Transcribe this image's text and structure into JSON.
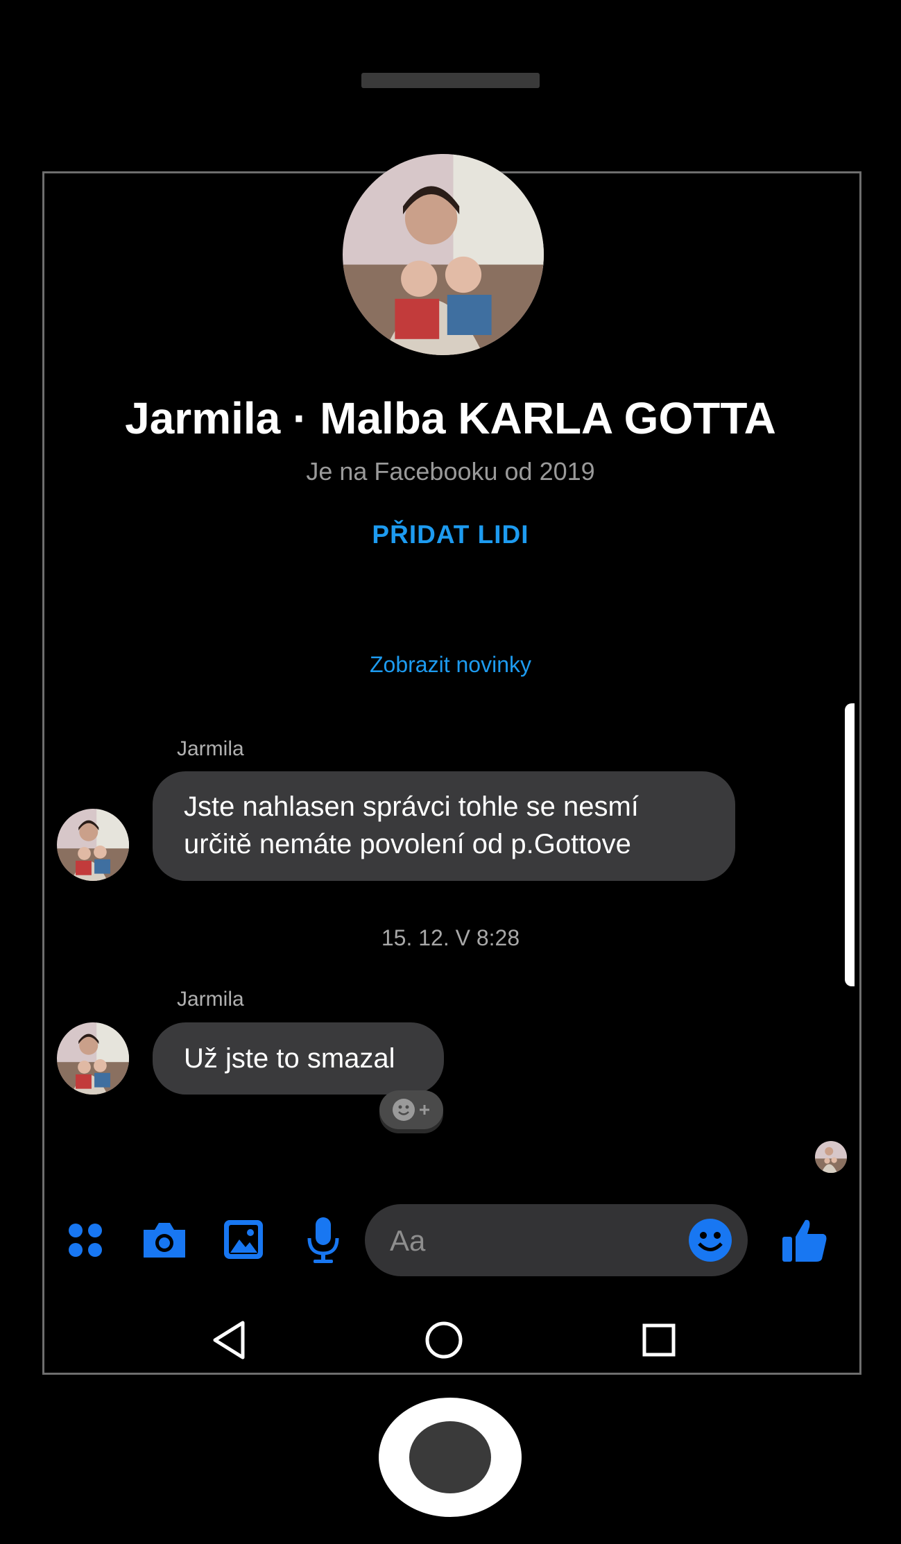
{
  "profile": {
    "title": "Jarmila · Malba KARLA GOTTA",
    "subtitle": "Je na Facebooku od 2019",
    "add_people": "PŘIDAT LIDI"
  },
  "news_link": "Zobrazit novinky",
  "messages": [
    {
      "sender": "Jarmila",
      "lines": [
        "Jste nahlasen správci tohle se nesmí",
        "určitě nemáte povolení od p.Gottove"
      ]
    },
    {
      "sender": "Jarmila",
      "lines": [
        "Už jste to smazal"
      ]
    }
  ],
  "timestamp": "15. 12. V 8:28",
  "composer": {
    "placeholder": "Aa"
  },
  "colors": {
    "accent": "#1d9bf0",
    "bubble": "#3a3a3c",
    "background": "#000000"
  },
  "icons": {
    "toolbar": [
      "apps-icon",
      "camera-icon",
      "gallery-icon",
      "microphone-icon",
      "emoji-icon",
      "thumbs-up-icon"
    ],
    "nav": [
      "back-icon",
      "home-icon",
      "recents-icon"
    ]
  }
}
